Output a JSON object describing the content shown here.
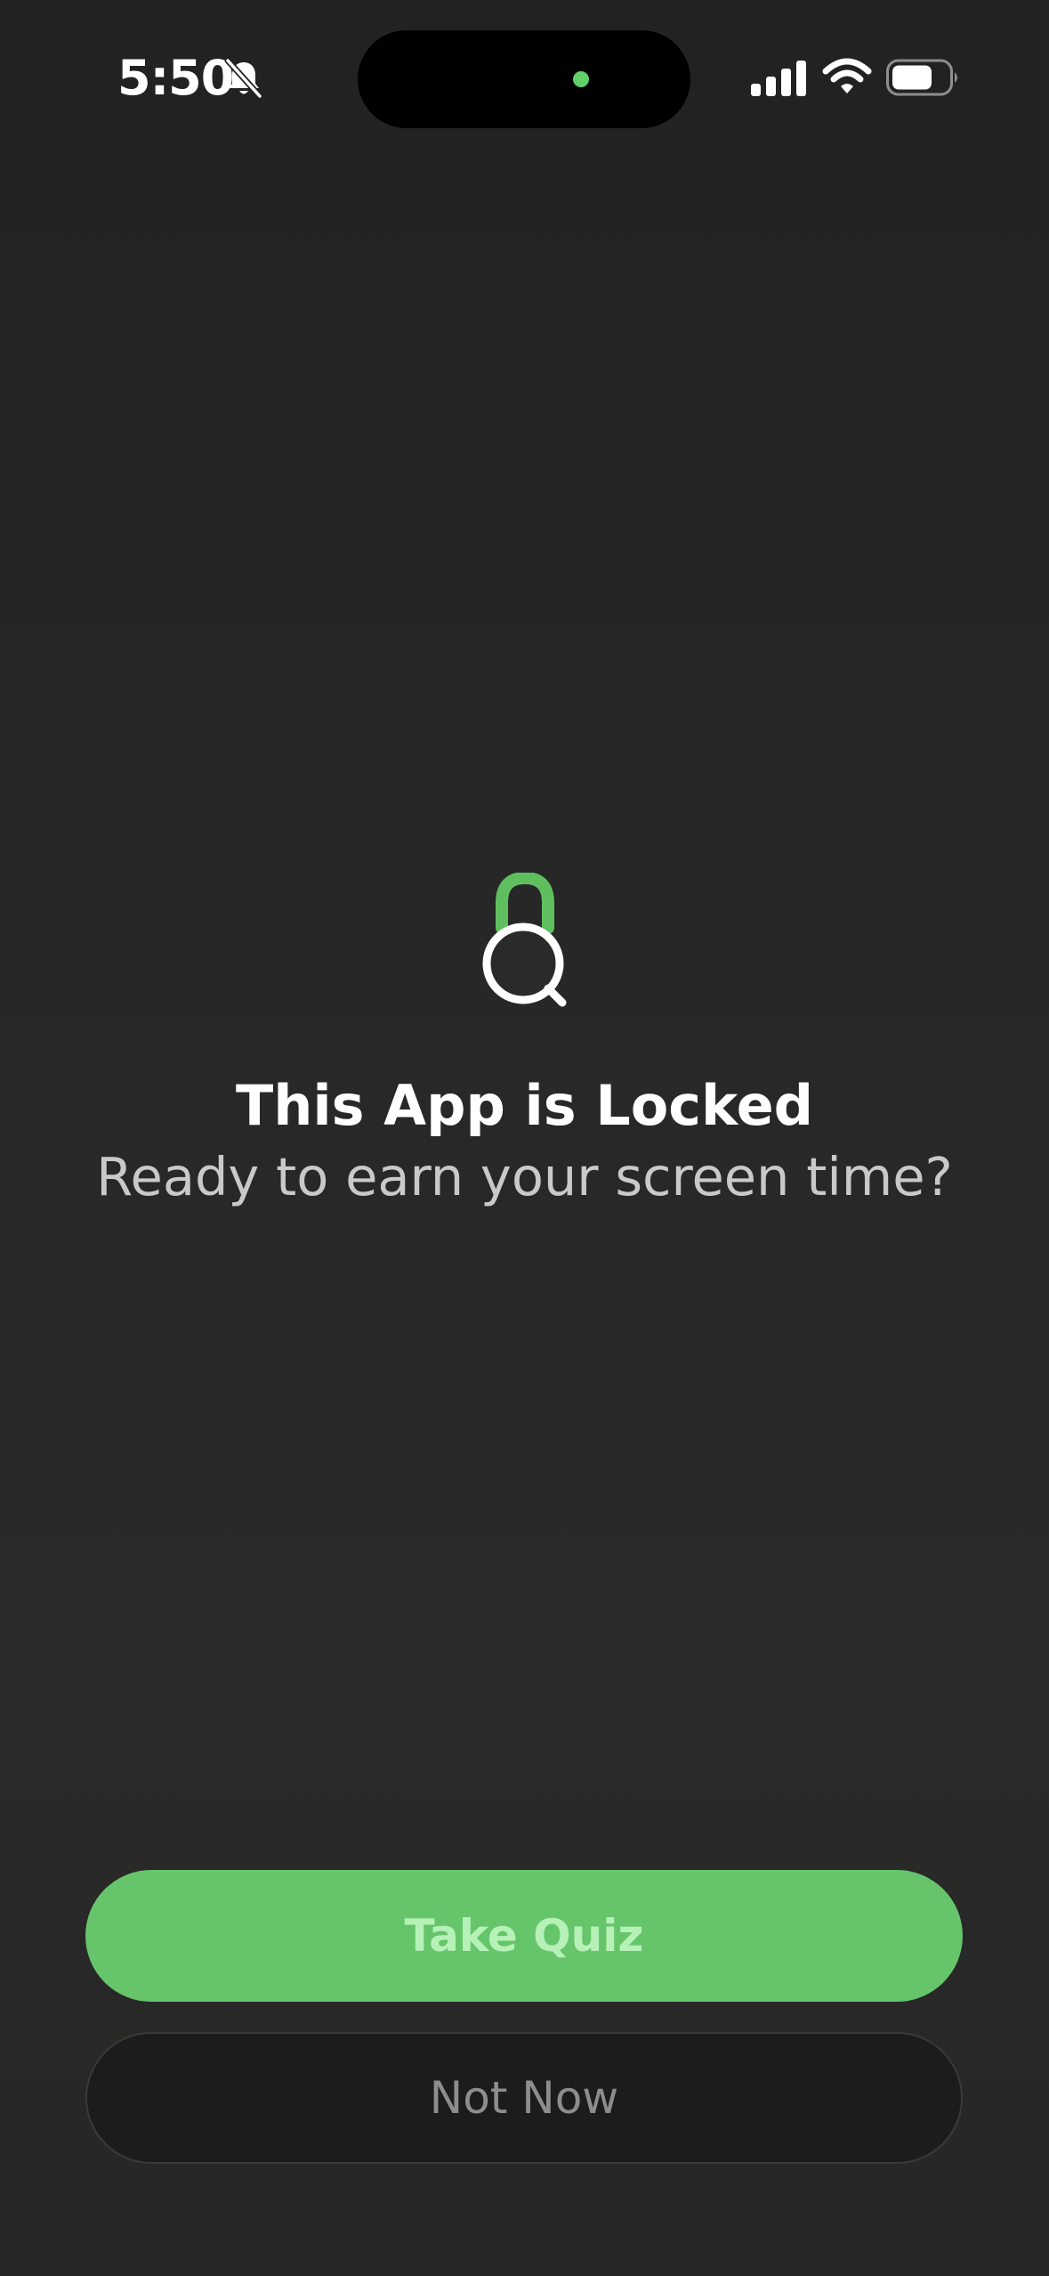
{
  "status_bar": {
    "time": "5:50",
    "silent_icon": "bell-slash-icon",
    "signal_icon": "cellular-signal-icon",
    "wifi_icon": "wifi-icon",
    "battery_icon": "battery-icon",
    "battery_level": 0.7,
    "camera_indicator_color": "#5fd06a"
  },
  "lock_screen": {
    "icon": "lock-search-icon",
    "icon_color": "#5fbf5f",
    "title": "This App is Locked",
    "subtitle": "Ready to earn your screen time?"
  },
  "actions": {
    "primary_label": "Take Quiz",
    "primary_color": "#66c56b",
    "secondary_label": "Not Now"
  }
}
